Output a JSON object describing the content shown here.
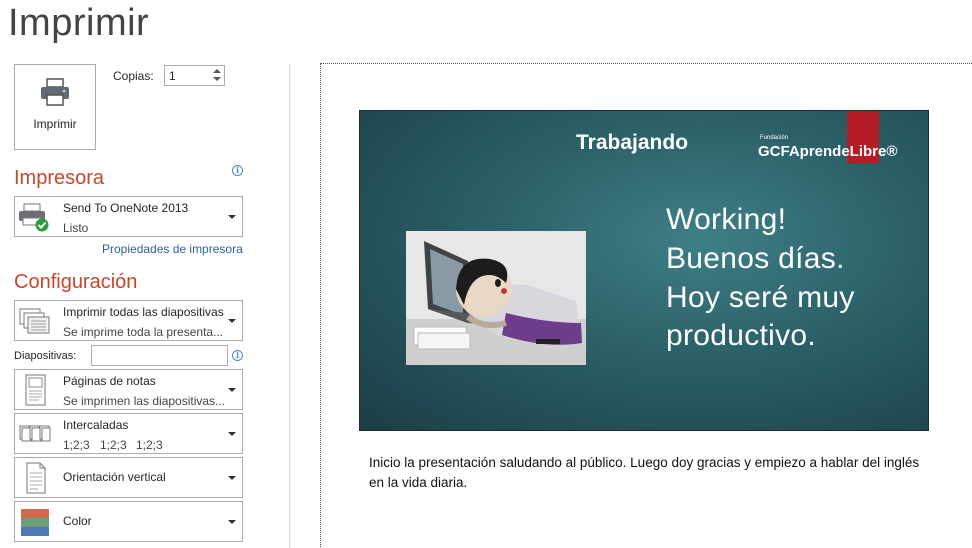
{
  "page": {
    "title": "Imprimir"
  },
  "print_button": {
    "label": "Imprimir",
    "icon": "printer-icon"
  },
  "copies": {
    "label": "Copias:",
    "value": "1"
  },
  "printer_section": {
    "heading": "Impresora",
    "device": {
      "name": "Send To OneNote 2013",
      "status": "Listo",
      "icon": "printer-ready-icon"
    },
    "properties_link": "Propiedades de impresora"
  },
  "settings_section": {
    "heading": "Configuración",
    "slides_range": {
      "title": "Imprimir todas las diapositivas",
      "subtitle": "Se imprime toda la presenta...",
      "icon": "slides-stack-icon"
    },
    "slides_field": {
      "label": "Diapositivas:",
      "value": ""
    },
    "layout": {
      "title": "Páginas de notas",
      "subtitle": "Se imprimen las diapositivas...",
      "icon": "notes-page-icon"
    },
    "collation": {
      "title": "Intercaladas",
      "subtitle_parts": [
        "1;2;3",
        "1;2;3",
        "1;2;3"
      ],
      "icon": "collated-icon"
    },
    "orientation": {
      "title": "Orientación vertical",
      "icon": "portrait-page-icon"
    },
    "color": {
      "title": "Color",
      "icon": "color-swatch-icon"
    }
  },
  "preview": {
    "slide": {
      "header_word": "Trabajando",
      "brand_prefix": "Fundación",
      "brand_name": "GCFAprendeLibre®",
      "body_lines": [
        "Working!",
        "Buenos días.",
        "Hoy seré muy",
        "productivo."
      ]
    },
    "notes_text": "Inicio la presentación saludando al público. Luego doy gracias y empiezo a hablar del inglés en la vida diaria."
  },
  "colors": {
    "accent_heading": "#c8462b",
    "link": "#2e5fa3",
    "slide_bg": "#2b5f67",
    "brand_red": "#b51c23"
  }
}
